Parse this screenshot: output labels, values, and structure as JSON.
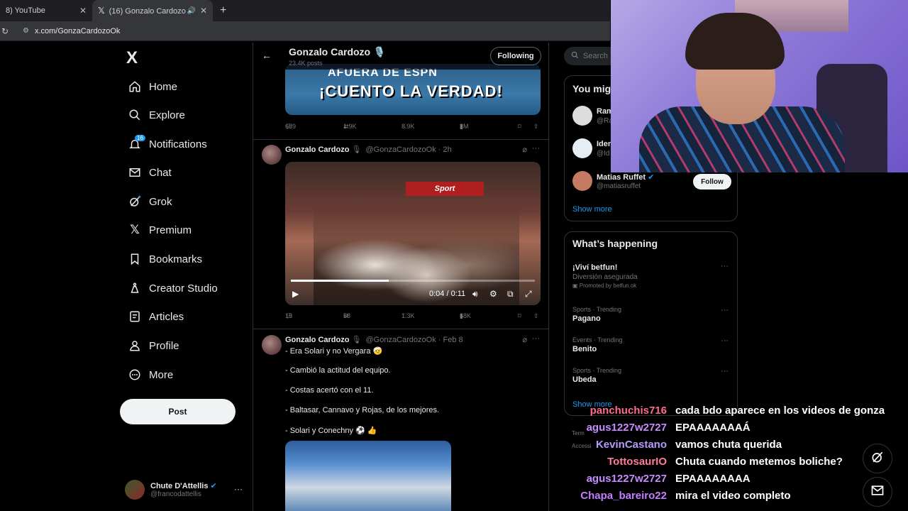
{
  "browser": {
    "tabs": [
      {
        "title": "8) YouTube",
        "active": false
      },
      {
        "title": "(16) Gonzalo Cardozo 🎙️ (",
        "active": true
      }
    ],
    "new_tab_icon": "plus-icon",
    "url": "x.com/GonzaCardozoOk"
  },
  "sidebar": {
    "logo": "X",
    "items": [
      {
        "label": "Home",
        "icon": "home-icon"
      },
      {
        "label": "Explore",
        "icon": "search-icon"
      },
      {
        "label": "Notifications",
        "icon": "bell-icon",
        "badge": "16"
      },
      {
        "label": "Chat",
        "icon": "mail-icon"
      },
      {
        "label": "Grok",
        "icon": "grok-icon"
      },
      {
        "label": "Premium",
        "icon": "x-icon"
      },
      {
        "label": "Bookmarks",
        "icon": "bookmark-icon"
      },
      {
        "label": "Creator Studio",
        "icon": "flask-icon"
      },
      {
        "label": "Articles",
        "icon": "article-icon"
      },
      {
        "label": "Profile",
        "icon": "person-icon"
      },
      {
        "label": "More",
        "icon": "more-circle-icon"
      }
    ],
    "post_label": "Post",
    "account": {
      "name": "Chute D'Attellis",
      "handle": "@francodattellis"
    }
  },
  "profile_header": {
    "name": "Gonzalo Cardozo 🎙️",
    "posts_count": "23.4K posts",
    "following_label": "Following"
  },
  "tweets": [
    {
      "thumbnail_line1": "AFUERA DE ESPN",
      "thumbnail_line2": "¡CUENTO LA VERDAD!",
      "replies": "689",
      "reposts": "1.9K",
      "likes": "8.9K",
      "views": "3M"
    },
    {
      "author": "Gonzalo Cardozo",
      "handle": "@GonzaCardozoOk",
      "time": "2h",
      "video_sign": "Sport",
      "video_time": "0:04 / 0:11",
      "video_progress_fraction": 0.4,
      "replies": "18",
      "reposts": "58",
      "likes": "1.3K",
      "views": "68K"
    },
    {
      "author": "Gonzalo Cardozo",
      "handle": "@GonzaCardozoOk",
      "time": "Feb 8",
      "lines": [
        "- Era Solari y no Vergara 🤕",
        "- Cambió la actitud del equipo.",
        "- Costas acertó con el 11.",
        "- Baltasar, Cannavo y Rojas, de los mejores.",
        "- Solari y Conechny ⚽️ 👍"
      ]
    }
  ],
  "right": {
    "search_placeholder": "Search",
    "who_to_follow_title": "You mig",
    "who_to_follow": [
      {
        "name": "Ram",
        "handle": "@Ra"
      },
      {
        "name": "Iden",
        "handle": "@Id"
      },
      {
        "name": "Matias Ruffet",
        "handle": "@matiasruffet"
      }
    ],
    "follow_label": "Follow",
    "show_more": "Show more",
    "whats_happening_title": "What’s happening",
    "trends": [
      {
        "meta": "",
        "title": "¡Viví betfun!",
        "sub": "Diversión asegurada",
        "promo": "Promoted by betfun.ok"
      },
      {
        "meta": "Sports · Trending",
        "title": "Pagano"
      },
      {
        "meta": "Events · Trending",
        "title": "Benito"
      },
      {
        "meta": "Sports · Trending",
        "title": "Ubeda"
      }
    ],
    "show_more_2": "Show more",
    "footer": [
      "Term",
      "Accessi"
    ]
  },
  "chat": [
    {
      "user": "panchuchis716",
      "msg": "cada bdo aparece en los videos de gonza",
      "color": "#ff6b8a"
    },
    {
      "user": "agus1227w2727",
      "msg": "EPAAAAAAAÁ",
      "color": "#c78bff"
    },
    {
      "user": "KevinCastano",
      "msg": "vamos chuta querida",
      "color": "#b59bff"
    },
    {
      "user": "TottosaurIO",
      "msg": "Chuta cuando metemos boliche?",
      "color": "#ff7b9c"
    },
    {
      "user": "agus1227w2727",
      "msg": "EPAAAAAAAA",
      "color": "#c78bff"
    },
    {
      "user": "Chapa_bareiro22",
      "msg": "mira el video completo",
      "color": "#c77dff"
    }
  ]
}
